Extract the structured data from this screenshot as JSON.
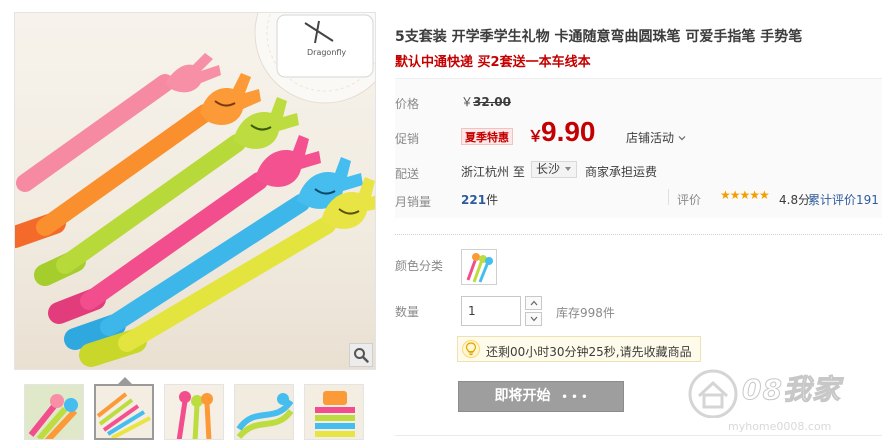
{
  "product": {
    "title": "5支套装 开学季学生礼物 卡通随意弯曲圆珠笔 可爱手指笔 手势笔",
    "subtitle": "默认中通快递 买2套送一本车线本"
  },
  "image": {
    "mug_text": "Dragonfly"
  },
  "price": {
    "label": "价格",
    "currency": "￥",
    "original": "32.00"
  },
  "promo": {
    "label": "促销",
    "tag": "夏季特惠",
    "currency": "￥",
    "value": "9.90",
    "shop_activity": "店铺活动"
  },
  "shipping": {
    "label": "配送",
    "from": "浙江杭州 至",
    "to": "长沙",
    "fee": "商家承担运费"
  },
  "sales": {
    "label": "月销量",
    "count": "221",
    "unit": "件",
    "review_label": "评价",
    "stars": "★★★★★",
    "score": "4.8分",
    "review_link": "累计评价191"
  },
  "color": {
    "label": "颜色分类"
  },
  "quantity": {
    "label": "数量",
    "value": "1",
    "stock": "库存998件"
  },
  "countdown": {
    "text": "还剩00小时30分钟25秒,请先收藏商品"
  },
  "buy_button": {
    "label": "即将开始",
    "dots": "• • •"
  },
  "watermark": {
    "big": "08我家",
    "small": "myhome0008.com"
  },
  "colors": {
    "accent_red": "#c40000",
    "link_blue": "#2d5b9f",
    "button_gray": "#9e9e9e"
  }
}
